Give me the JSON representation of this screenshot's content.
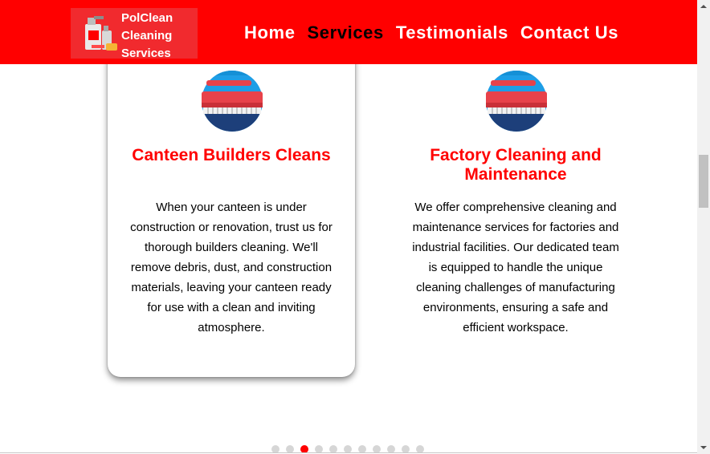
{
  "brand": {
    "name_lines": [
      "PolClean",
      "Cleaning",
      "Services"
    ]
  },
  "nav": {
    "items": [
      {
        "label": "Home"
      },
      {
        "label": "Services"
      },
      {
        "label": "Testimonials"
      },
      {
        "label": "Contact Us"
      }
    ],
    "active": "Services"
  },
  "services": [
    {
      "title": "Canteen Builders Cleans",
      "description": "When your canteen is under construction or renovation, trust us for thorough builders cleaning. We'll remove debris, dust, and construction materials, leaving your canteen ready for use with a clean and inviting atmosphere.",
      "icon": "scrub-brush-icon"
    },
    {
      "title": "Factory Cleaning and Maintenance",
      "description": "We offer comprehensive cleaning and maintenance services for factories and industrial facilities. Our dedicated team is equipped to handle the unique cleaning challenges of manufacturing environments, ensuring a safe and efficient workspace.",
      "icon": "scrub-brush-icon"
    }
  ],
  "carousel": {
    "total_slides": 11,
    "active_slide": 3
  },
  "colors": {
    "brand_red": "#ff0000",
    "logo_bg": "#f12a2e",
    "title_red": "#ff0000",
    "icon_blue": "#1e9ee6",
    "icon_navy": "#1d3f7a",
    "brush_red": "#e8424a"
  }
}
